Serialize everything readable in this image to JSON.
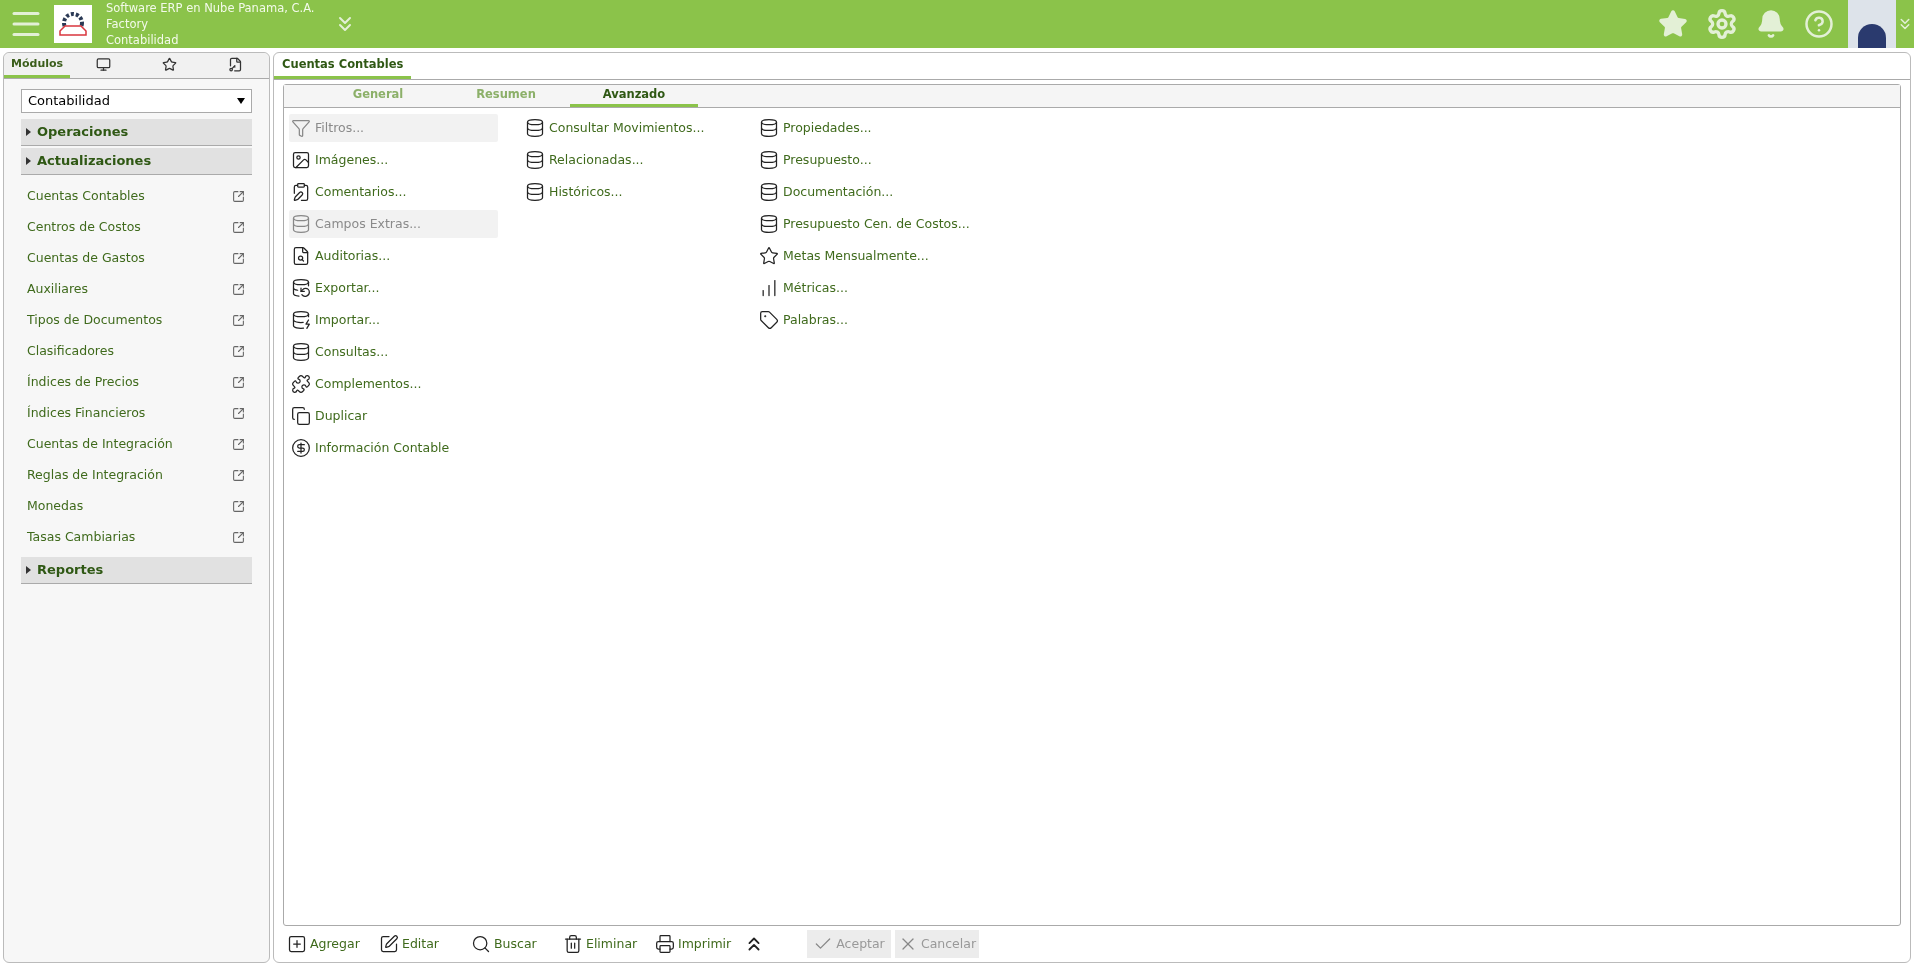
{
  "header": {
    "company": "Software ERP en Nube Panama, C.A.",
    "database": "Factory",
    "module": "Contabilidad"
  },
  "sidebar": {
    "tabs": [
      {
        "label": "Módulos",
        "kind": "text",
        "selected": true
      },
      {
        "kind": "monitor",
        "selected": false
      },
      {
        "kind": "star",
        "selected": false
      },
      {
        "kind": "key",
        "selected": false
      }
    ],
    "module_select": {
      "value": "Contabilidad"
    },
    "sections": [
      {
        "label": "Operaciones"
      },
      {
        "label": "Actualizaciones",
        "children": [
          {
            "label": "Cuentas Contables"
          },
          {
            "label": "Centros de Costos"
          },
          {
            "label": "Cuentas de Gastos"
          },
          {
            "label": "Auxiliares"
          },
          {
            "label": "Tipos de Documentos"
          },
          {
            "label": "Clasificadores"
          },
          {
            "label": "Índices de Precios"
          },
          {
            "label": "Índices Financieros"
          },
          {
            "label": "Cuentas de Integración"
          },
          {
            "label": "Reglas de Integración"
          },
          {
            "label": "Monedas"
          },
          {
            "label": "Tasas Cambiarias"
          }
        ]
      },
      {
        "label": "Reportes"
      }
    ]
  },
  "document_tab": {
    "label": "Cuentas Contables"
  },
  "sub_tabs": [
    {
      "label": "General",
      "selected": false
    },
    {
      "label": "Resumen",
      "selected": false
    },
    {
      "label": "Avanzado",
      "selected": true
    }
  ],
  "menu_columns": [
    [
      {
        "label": "Filtros...",
        "kind": "filter",
        "disabled": true
      },
      {
        "label": "Imágenes...",
        "kind": "image",
        "disabled": false
      },
      {
        "label": "Comentarios...",
        "kind": "clipboard",
        "disabled": false
      },
      {
        "label": "Campos Extras...",
        "kind": "database",
        "disabled": true
      },
      {
        "label": "Auditorias...",
        "kind": "audit",
        "disabled": false
      },
      {
        "label": "Exportar...",
        "kind": "export",
        "disabled": false
      },
      {
        "label": "Importar...",
        "kind": "import",
        "disabled": false
      },
      {
        "label": "Consultas...",
        "kind": "database",
        "disabled": false
      },
      {
        "label": "Complementos...",
        "kind": "puzzle",
        "disabled": false
      },
      {
        "label": "Duplicar",
        "kind": "copy",
        "disabled": false
      },
      {
        "label": "Información Contable",
        "kind": "dollar",
        "disabled": false
      }
    ],
    [
      {
        "label": "Consultar Movimientos...",
        "kind": "database",
        "disabled": false
      },
      {
        "label": "Relacionadas...",
        "kind": "database",
        "disabled": false
      },
      {
        "label": "Históricos...",
        "kind": "database",
        "disabled": false
      }
    ],
    [
      {
        "label": "Propiedades...",
        "kind": "database",
        "disabled": false
      },
      {
        "label": "Presupuesto...",
        "kind": "database",
        "disabled": false
      },
      {
        "label": "Documentación...",
        "kind": "database",
        "disabled": false
      },
      {
        "label": "Presupuesto Cen. de Costos...",
        "kind": "database",
        "disabled": false
      },
      {
        "label": "Metas Mensualmente...",
        "kind": "star",
        "disabled": false
      },
      {
        "label": "Métricas...",
        "kind": "chart",
        "disabled": false
      },
      {
        "label": "Palabras...",
        "kind": "tag",
        "disabled": false
      }
    ]
  ],
  "toolbar": [
    {
      "label": "Agregar",
      "kind": "add",
      "disabled": false
    },
    {
      "label": "Editar",
      "kind": "edit",
      "disabled": false
    },
    {
      "label": "Buscar",
      "kind": "search",
      "disabled": false
    },
    {
      "label": "Eliminar",
      "kind": "delete",
      "disabled": false
    },
    {
      "label": "Imprimir",
      "kind": "print",
      "disabled": false
    },
    {
      "kind": "more"
    },
    {
      "label": "Aceptar",
      "kind": "accept",
      "disabled": true
    },
    {
      "label": "Cancelar",
      "kind": "cancel",
      "disabled": true
    }
  ]
}
